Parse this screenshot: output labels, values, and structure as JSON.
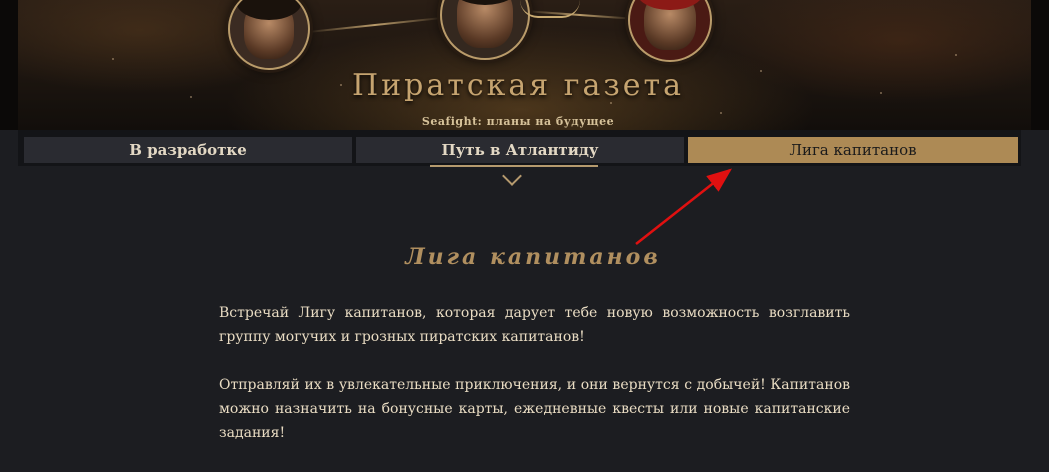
{
  "header": {
    "title": "Пиратская газета",
    "subtitle": "Seafight: планы на будущее"
  },
  "tabs": [
    {
      "label": "В разработке",
      "active": false
    },
    {
      "label": "Путь в Атлантиду",
      "active": false
    },
    {
      "label": "Лига капитанов",
      "active": true
    }
  ],
  "content": {
    "title": "Лига капитанов",
    "paragraphs": [
      "Встречай Лигу капитанов, которая дарует тебе новую возможность возглавить группу могучих и грозных пиратских капитанов!",
      "Отправляй их в увлекательные приключения, и они вернутся с добычей! Капитанов можно назначить на бонусные карты, ежедневные квесты или новые капитанские задания!"
    ]
  },
  "colors": {
    "accent_gold": "#ad8a55",
    "annotation_arrow": "#e01010",
    "background": "#1c1d21"
  }
}
